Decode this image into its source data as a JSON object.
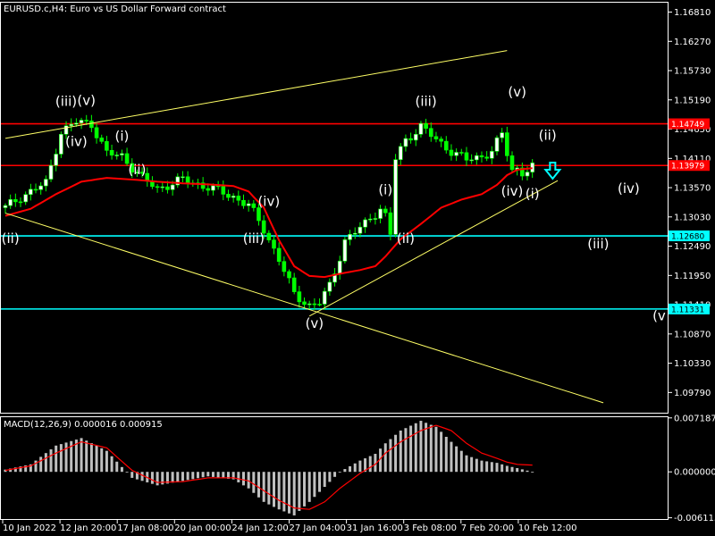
{
  "title": "EURUSD.c,H4:  Euro vs US Dollar Forward contract",
  "macd_title": "MACD(12,26,9) 0.000016 0.000915",
  "colors": {
    "background": "#000000",
    "frame": "#ffffff",
    "bull_candle": "#ffffff",
    "bear_candle": "#00ff00",
    "wick": "#00ff00",
    "moving_average": "#ff0000",
    "trendline": "#ffff66",
    "resistance_line": "#ff0000",
    "support_line": "#00ffff",
    "macd_histogram": "#c0c0c0",
    "macd_signal": "#ff0000",
    "arrow": "#00ffff"
  },
  "chart_data": [
    {
      "type": "candlestick",
      "symbol": "EURUSD.c",
      "timeframe": "H4",
      "x_tick_labels": [
        "10 Jan 2022",
        "12 Jan 20:00",
        "17 Jan 08:00",
        "20 Jan 00:00",
        "24 Jan 12:00",
        "27 Jan 04:00",
        "31 Jan 16:00",
        "3 Feb 08:00",
        "7 Feb 20:00",
        "10 Feb 12:00"
      ],
      "y_tick_labels": [
        "1.16810",
        "1.16270",
        "1.15730",
        "1.15190",
        "1.14650",
        "1.14110",
        "1.13570",
        "1.13030",
        "1.12490",
        "1.11950",
        "1.11410",
        "1.10870",
        "1.10330",
        "1.09790"
      ],
      "ylim": [
        1.094,
        1.17
      ],
      "price_tags": [
        {
          "value": 1.14749,
          "label": "1.14749",
          "color": "#ff0000"
        },
        {
          "value": 1.13979,
          "label": "1.13979",
          "color": "#ff0000"
        },
        {
          "value": 1.1268,
          "label": "1.12680",
          "color": "#00ffff"
        },
        {
          "value": 1.11331,
          "label": "1.11331",
          "color": "#00ffff"
        }
      ],
      "horizontal_lines": [
        {
          "value": 1.14749,
          "color": "#ff0000"
        },
        {
          "value": 1.13979,
          "color": "#ff0000"
        },
        {
          "value": 1.1268,
          "color": "#00ffff"
        },
        {
          "value": 1.11331,
          "color": "#00ffff"
        }
      ],
      "trendlines": [
        {
          "x": [
            0,
            99
          ],
          "y": [
            1.1448,
            1.161
          ]
        },
        {
          "x": [
            0,
            118
          ],
          "y": [
            1.131,
            1.096
          ]
        },
        {
          "x": [
            60,
            109
          ],
          "y": [
            1.112,
            1.137
          ]
        }
      ],
      "close_anchors": {
        "x": [
          0,
          3,
          8,
          11,
          14,
          17,
          20,
          23,
          27,
          30,
          35,
          40,
          45,
          48,
          51,
          54,
          57,
          60,
          62,
          64,
          66,
          67,
          69,
          71,
          74,
          75,
          76,
          77,
          79,
          82,
          85,
          88,
          91,
          94,
          96,
          98,
          99,
          100,
          101,
          102,
          103,
          104
        ],
        "y": [
          1.132,
          1.134,
          1.1365,
          1.146,
          1.1478,
          1.1475,
          1.142,
          1.1415,
          1.1375,
          1.1355,
          1.1372,
          1.1358,
          1.134,
          1.1325,
          1.128,
          1.1225,
          1.116,
          1.114,
          1.1145,
          1.1175,
          1.123,
          1.126,
          1.1275,
          1.129,
          1.132,
          1.1305,
          1.127,
          1.141,
          1.1445,
          1.147,
          1.1445,
          1.1425,
          1.1408,
          1.1415,
          1.1425,
          1.1455,
          1.142,
          1.139,
          1.1392,
          1.1385,
          1.139,
          1.1395
        ]
      },
      "moving_average": {
        "x": [
          0,
          5,
          10,
          15,
          20,
          25,
          30,
          35,
          40,
          45,
          48,
          51,
          54,
          57,
          60,
          63,
          66,
          70,
          73,
          75,
          78,
          82,
          86,
          90,
          94,
          97,
          99,
          101,
          104
        ],
        "y": [
          1.1305,
          1.1318,
          1.1345,
          1.1368,
          1.1375,
          1.1372,
          1.1368,
          1.1365,
          1.1363,
          1.136,
          1.135,
          1.132,
          1.126,
          1.1212,
          1.1194,
          1.1192,
          1.1198,
          1.1205,
          1.1212,
          1.123,
          1.1262,
          1.129,
          1.132,
          1.1335,
          1.1345,
          1.1362,
          1.138,
          1.139,
          1.1393
        ]
      },
      "wave_labels": [
        {
          "text": "(ii)",
          "x": 1,
          "y": 1.1255
        },
        {
          "text": "(iii)",
          "x": 12,
          "y": 1.1508
        },
        {
          "text": "(v)",
          "x": 16,
          "y": 1.151
        },
        {
          "text": "(iv)",
          "x": 14,
          "y": 1.1434
        },
        {
          "text": "(i)",
          "x": 23,
          "y": 1.1444
        },
        {
          "text": "(ii)",
          "x": 26,
          "y": 1.1382
        },
        {
          "text": "(iv)",
          "x": 52,
          "y": 1.1323
        },
        {
          "text": "(iii)",
          "x": 49,
          "y": 1.1255
        },
        {
          "text": "(v)",
          "x": 61,
          "y": 1.1098
        },
        {
          "text": "(i)",
          "x": 75,
          "y": 1.1345
        },
        {
          "text": "(ii)",
          "x": 79,
          "y": 1.1255
        },
        {
          "text": "(iii)",
          "x": 83,
          "y": 1.1508
        },
        {
          "text": "(v)",
          "x": 101,
          "y": 1.1525
        },
        {
          "text": "(ii)",
          "x": 107,
          "y": 1.1445
        },
        {
          "text": "(iv)",
          "x": 100,
          "y": 1.1342
        },
        {
          "text": "(i)",
          "x": 104,
          "y": 1.1337
        },
        {
          "text": "(iv)",
          "x": 123,
          "y": 1.1347
        },
        {
          "text": "(iii)",
          "x": 117,
          "y": 1.1245
        },
        {
          "text": "(v",
          "x": 129,
          "y": 1.1112
        }
      ],
      "arrow": {
        "x": 108,
        "y": 1.139,
        "direction": "down"
      }
    },
    {
      "type": "bar",
      "indicator": "MACD(12,26,9)",
      "values": [
        1.6e-05,
        0.000915
      ],
      "y_tick_labels": [
        "0.007187",
        "0.000000",
        "-0.006115"
      ],
      "ylim": [
        -0.0064,
        0.0074
      ],
      "histogram_anchors": {
        "x": [
          0,
          5,
          10,
          15,
          20,
          25,
          30,
          35,
          40,
          45,
          48,
          51,
          54,
          57,
          60,
          63,
          66,
          70,
          73,
          75,
          78,
          82,
          85,
          88,
          91,
          94,
          97,
          99,
          101,
          104
        ],
        "y": [
          0.0003,
          0.001,
          0.0035,
          0.0045,
          0.0028,
          -0.0008,
          -0.0018,
          -0.0012,
          -0.0006,
          -0.001,
          -0.0022,
          -0.004,
          -0.005,
          -0.0058,
          -0.004,
          -0.002,
          0.0,
          0.0015,
          0.0024,
          0.0038,
          0.0055,
          0.0068,
          0.006,
          0.004,
          0.0022,
          0.0015,
          0.0012,
          0.0008,
          0.0005,
          0.0
        ]
      },
      "signal_anchors": {
        "x": [
          0,
          5,
          10,
          15,
          20,
          25,
          30,
          35,
          40,
          45,
          48,
          51,
          54,
          57,
          60,
          63,
          66,
          70,
          73,
          75,
          78,
          82,
          85,
          88,
          91,
          94,
          97,
          99,
          101,
          104
        ],
        "y": [
          0.0002,
          0.0008,
          0.0025,
          0.004,
          0.0032,
          0.0002,
          -0.0014,
          -0.0013,
          -0.0008,
          -0.0008,
          -0.0012,
          -0.0025,
          -0.0038,
          -0.0048,
          -0.005,
          -0.004,
          -0.0022,
          -0.0002,
          0.001,
          0.0025,
          0.004,
          0.0055,
          0.0062,
          0.0055,
          0.0038,
          0.0025,
          0.0018,
          0.0013,
          0.001,
          0.0009
        ]
      }
    }
  ]
}
